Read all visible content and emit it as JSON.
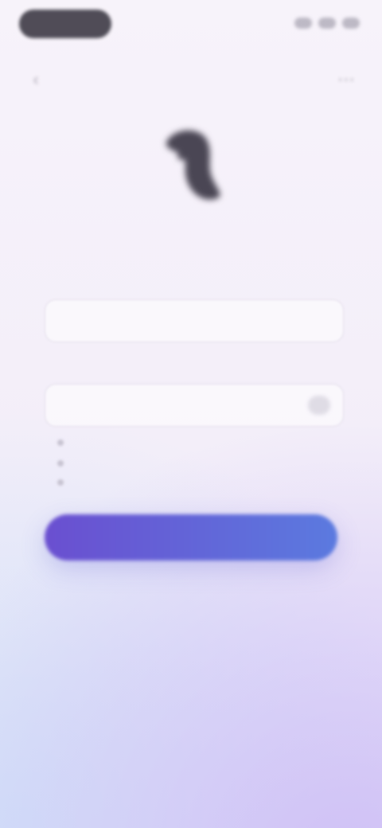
{
  "nav": {
    "back_icon": "chevron-left-icon",
    "menu_icon": "ellipsis-icon"
  },
  "header": {
    "logo": "brand-logo",
    "title": ""
  },
  "form": {
    "email_label": "",
    "email_value": "",
    "password_label": "",
    "password_value": "",
    "password_toggle_icon": "eye-icon",
    "password_rules": [
      "",
      "",
      ""
    ]
  },
  "actions": {
    "primary_button": "",
    "forgot_link": "",
    "signup_link": ""
  },
  "colors": {
    "background_top": "#f7f3fa",
    "background_bottom": "#e8e4f8",
    "button_start": "#6a4fd0",
    "button_end": "#5b7adf",
    "text_primary": "#35323c"
  }
}
